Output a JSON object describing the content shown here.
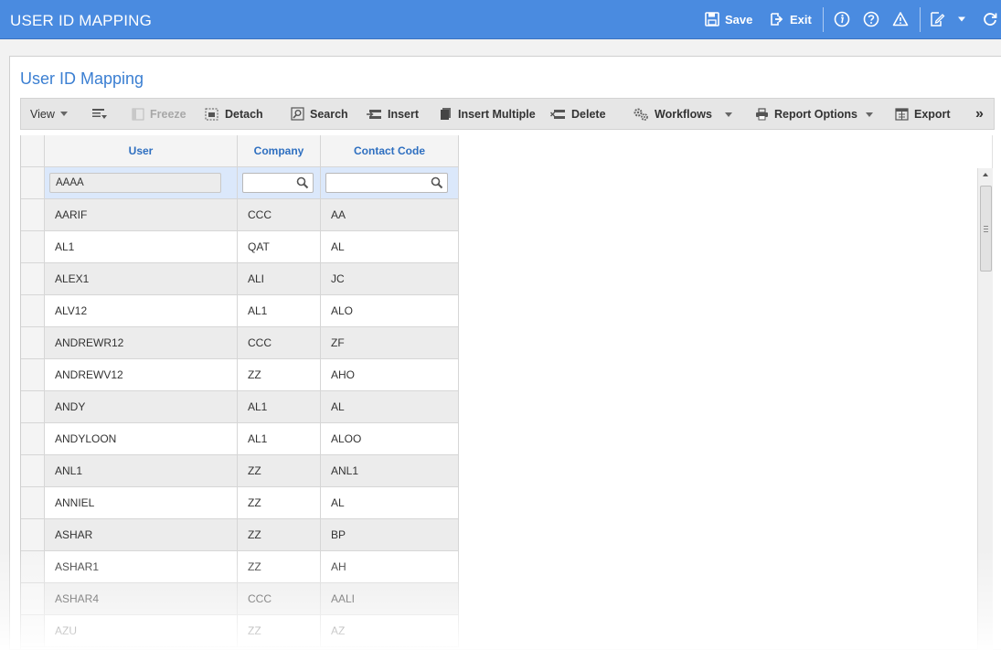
{
  "app": {
    "title": "USER ID MAPPING",
    "header_buttons": {
      "save": "Save",
      "exit": "Exit"
    }
  },
  "panel": {
    "title": "User ID Mapping"
  },
  "toolbar": {
    "view": "View",
    "freeze": "Freeze",
    "detach": "Detach",
    "search": "Search",
    "insert": "Insert",
    "insert_multiple": "Insert Multiple",
    "delete": "Delete",
    "workflows": "Workflows",
    "report_options": "Report Options",
    "export": "Export",
    "more": "»"
  },
  "grid": {
    "columns": [
      "User",
      "Company",
      "Contact Code"
    ],
    "filters": {
      "user": "AAAA",
      "company": "",
      "contact_code": ""
    },
    "rows": [
      [
        "AARIF",
        "CCC",
        "AA"
      ],
      [
        "AL1",
        "QAT",
        "AL"
      ],
      [
        "ALEX1",
        "ALI",
        "JC"
      ],
      [
        "ALV12",
        "AL1",
        "ALO"
      ],
      [
        "ANDREWR12",
        "CCC",
        "ZF"
      ],
      [
        "ANDREWV12",
        "ZZ",
        "AHO"
      ],
      [
        "ANDY",
        "AL1",
        "AL"
      ],
      [
        "ANDYLOON",
        "AL1",
        "ALOO"
      ],
      [
        "ANL1",
        "ZZ",
        "ANL1"
      ],
      [
        "ANNIEL",
        "ZZ",
        "AL"
      ],
      [
        "ASHAR",
        "ZZ",
        "BP"
      ],
      [
        "ASHAR1",
        "ZZ",
        "AH"
      ],
      [
        "ASHAR4",
        "CCC",
        "AALI"
      ],
      [
        "AZU",
        "ZZ",
        "AZ"
      ]
    ]
  },
  "colors": {
    "accent": "#4a8be0",
    "title_blue": "#3b7fd2",
    "header_blue": "#2e6fc0"
  }
}
